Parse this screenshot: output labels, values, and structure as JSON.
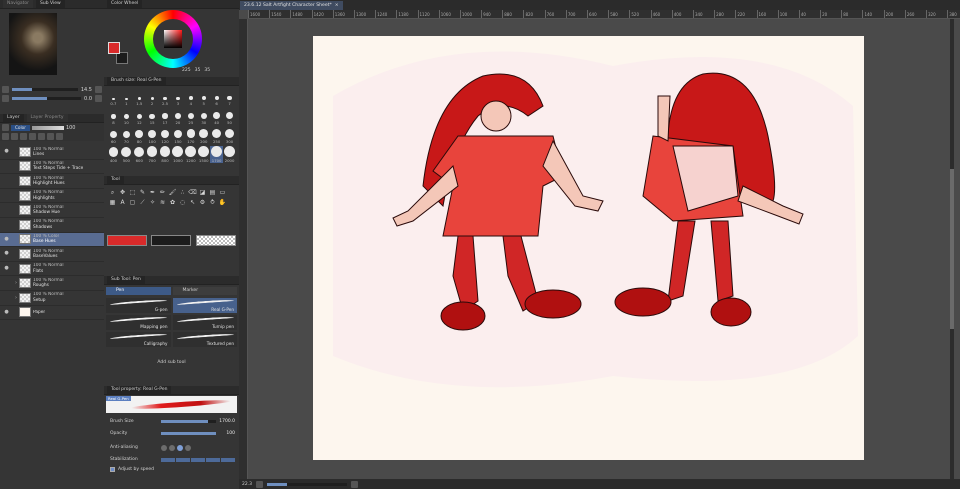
{
  "subview": {
    "tabs": [
      "Navigator",
      "Sub View"
    ],
    "zoom": "14.5",
    "rotate": "0.0"
  },
  "layers": {
    "tabs": [
      "Layer",
      "Layer Property"
    ],
    "blend_mode": "Color",
    "opacity": "100",
    "items": [
      {
        "mode": "100 % Normal",
        "name": "Lines",
        "selected": false,
        "folder": false,
        "visible": true
      },
      {
        "mode": "100 % Normal",
        "name": "Text Steps Tide + Trace",
        "selected": false,
        "folder": false,
        "visible": false
      },
      {
        "mode": "100 % Normal",
        "name": "Highlight Hues",
        "selected": false,
        "folder": false,
        "visible": false
      },
      {
        "mode": "100 % Normal",
        "name": "Highlights",
        "selected": false,
        "folder": false,
        "visible": false
      },
      {
        "mode": "100 % Normal",
        "name": "Shadow Hue",
        "selected": false,
        "folder": false,
        "visible": false
      },
      {
        "mode": "100 % Normal",
        "name": "Shadows",
        "selected": false,
        "folder": false,
        "visible": false
      },
      {
        "mode": "100 % Color",
        "name": "Base Hues",
        "selected": true,
        "folder": false,
        "visible": true
      },
      {
        "mode": "100 % Normal",
        "name": "BaseValues",
        "selected": false,
        "folder": false,
        "visible": true
      },
      {
        "mode": "100 % Normal",
        "name": "Flats",
        "selected": false,
        "folder": false,
        "visible": true
      },
      {
        "mode": "100 % Normal",
        "name": "Roughs",
        "selected": false,
        "folder": true,
        "visible": false
      },
      {
        "mode": "100 % Normal",
        "name": "Setup",
        "selected": false,
        "folder": true,
        "visible": false
      },
      {
        "mode": "",
        "name": "Paper",
        "selected": false,
        "folder": false,
        "visible": true
      }
    ]
  },
  "color_wheel": {
    "title": "Color Wheel",
    "main_color": "#d92a2a",
    "sub_color": "#1c1c1c",
    "h": "225",
    "s": "35",
    "v": "35"
  },
  "brush_size": {
    "title": "Brush size: Real G-Pen",
    "sizes": [
      "0.7",
      "1",
      "1.5",
      "2",
      "2.5",
      "3",
      "4",
      "5",
      "6",
      "7",
      "8",
      "10",
      "12",
      "15",
      "17",
      "20",
      "25",
      "30",
      "40",
      "50",
      "60",
      "70",
      "80",
      "100",
      "120",
      "150",
      "170",
      "200",
      "250",
      "300",
      "400",
      "500",
      "600",
      "700",
      "800",
      "1000",
      "1200",
      "1500",
      "1700",
      "2000"
    ],
    "selected": "1700"
  },
  "tool": {
    "title": "Tool",
    "icons": [
      "zoom-icon",
      "move-icon",
      "select-icon",
      "eyedropper-icon",
      "pen-icon",
      "pencil-icon",
      "brush-icon",
      "airbrush-icon",
      "eraser-icon",
      "fill-icon",
      "gradient-icon",
      "figure-icon",
      "frame-icon",
      "text-icon",
      "balloon-icon",
      "ruler-icon",
      "correct-icon",
      "blend-icon",
      "decoration-icon",
      "lasso-icon",
      "object-icon",
      "operation-icon",
      "liquify-icon",
      "hand-icon"
    ],
    "main_color": "#d92a2a",
    "sub_color": "#1c1c1c"
  },
  "sub_tool": {
    "title": "Sub Tool: Pen",
    "tabs": [
      "Pen",
      "Marker"
    ],
    "active_tab": "Pen",
    "items": [
      "G-pen",
      "Real G-Pen",
      "Mapping pen",
      "Turnip pen",
      "Calligraphy",
      "Textured pen"
    ],
    "selected": "Real G-Pen",
    "add_label": "Add sub tool"
  },
  "tool_property": {
    "title": "Tool property: Real G-Pen",
    "preview_tag": "Real G-Pen",
    "brush_size_label": "Brush Size",
    "brush_size_value": "1700.0",
    "brush_size_level": 0.85,
    "opacity_label": "Opacity",
    "opacity_value": "100",
    "anti_alias_label": "Anti-aliasing",
    "stabilization_label": "Stabilization",
    "adjust_speed_label": "Adjust by speed"
  },
  "canvas": {
    "doc_tab": "23.6.12 Salt Artfight Character Sheet*",
    "ruler_ticks": [
      "1600",
      "1540",
      "1480",
      "1420",
      "1360",
      "1300",
      "1240",
      "1180",
      "1120",
      "1060",
      "1000",
      "940",
      "880",
      "820",
      "760",
      "700",
      "640",
      "580",
      "520",
      "460",
      "400",
      "340",
      "280",
      "220",
      "160",
      "100",
      "40",
      "20",
      "80",
      "140",
      "200",
      "260",
      "320",
      "380",
      "440",
      "500",
      "560"
    ],
    "paper_color": "#fdf6ee",
    "accent": "#d42020"
  },
  "status": {
    "zoom": "22.3"
  }
}
